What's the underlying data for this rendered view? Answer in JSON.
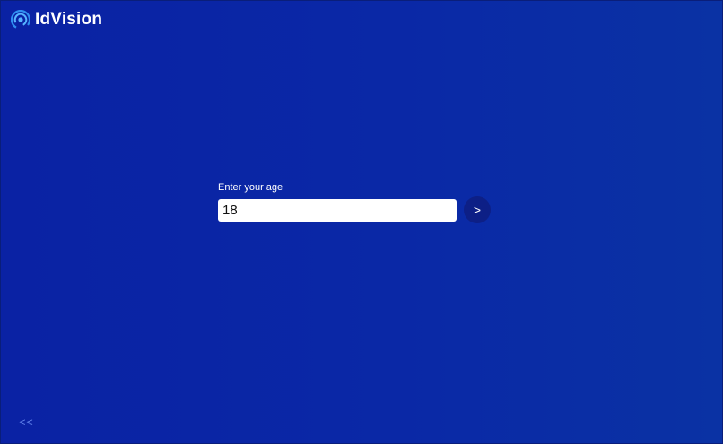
{
  "brand": {
    "name": "IdVision",
    "logo_icon": "fingerprint-eye-icon",
    "logo_colors": [
      "#2f8ef0",
      "#56b4ff"
    ]
  },
  "colors": {
    "background": "#0a26a5",
    "accent": "#3aa4ff",
    "button": "#0d1f86",
    "back_link": "#5f7fe8"
  },
  "form": {
    "label": "Enter your age",
    "age_value": "18",
    "next_label": ">"
  },
  "navigation": {
    "back_label": "<<"
  }
}
